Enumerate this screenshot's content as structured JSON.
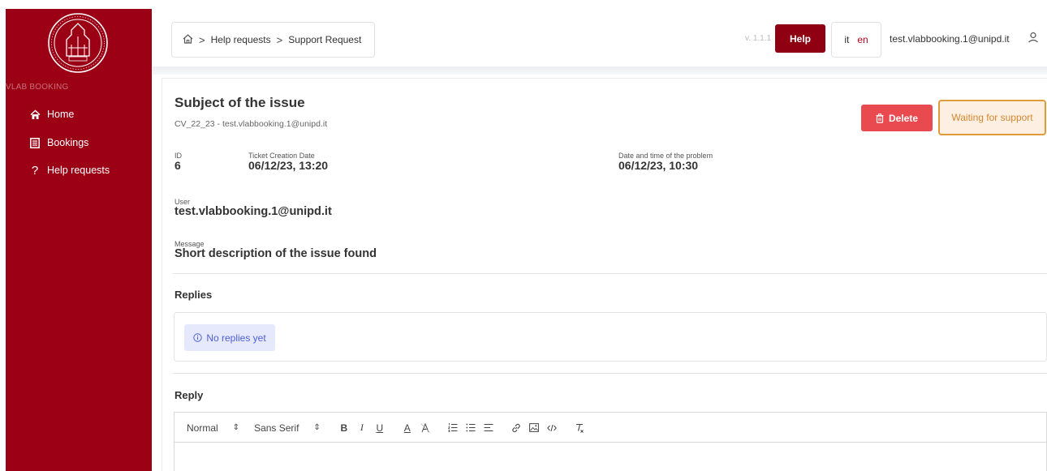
{
  "sidebar": {
    "brand": "VLAB BOOKING",
    "items": [
      {
        "label": "Home",
        "icon": "home-icon"
      },
      {
        "label": "Bookings",
        "icon": "bookings-icon"
      },
      {
        "label": "Help requests",
        "icon": "question-icon"
      }
    ]
  },
  "breadcrumb": {
    "items": [
      "Help requests",
      "Support Request"
    ],
    "separator": ">"
  },
  "header": {
    "version": "v. 1.1.1",
    "help_label": "Help",
    "lang_it": "it",
    "lang_en": "en",
    "user_email": "test.vlabbooking.1@unipd.it"
  },
  "ticket": {
    "subject": "Subject of the issue",
    "subline": "CV_22_23 - test.vlabbooking.1@unipd.it",
    "delete_label": "Delete",
    "status": "Waiting for support",
    "id_label": "ID",
    "id_value": "6",
    "creation_label": "Ticket Creation Date",
    "creation_value": "06/12/23, 13:20",
    "problem_label": "Date and time of the problem",
    "problem_value": "06/12/23, 10:30",
    "user_label": "User",
    "user_value": "test.vlabbooking.1@unipd.it",
    "message_label": "Message",
    "message_value": "Short description of the issue found"
  },
  "replies": {
    "title": "Replies",
    "empty_text": "No replies yet"
  },
  "reply": {
    "title": "Reply",
    "format_select": "Normal",
    "font_select": "Sans Serif"
  },
  "colors": {
    "brand": "#9b0014",
    "help_button": "#8e0012",
    "delete_button": "#e84a50",
    "status_border": "#e09a3a",
    "info": "#4c5fd3"
  }
}
